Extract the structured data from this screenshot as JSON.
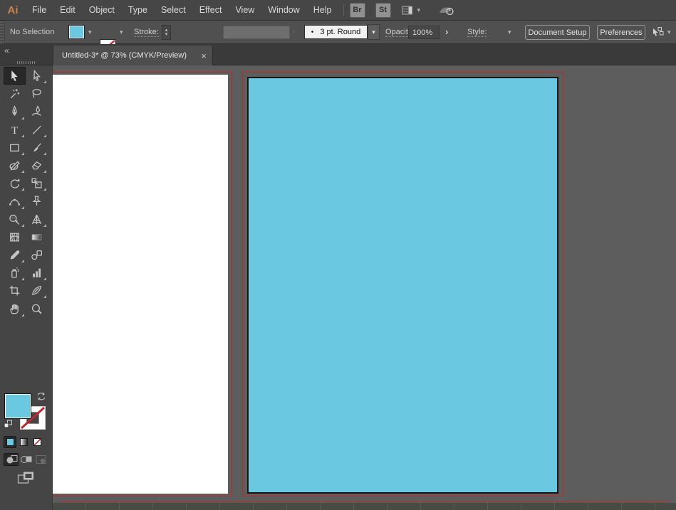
{
  "app": {
    "name": "Adobe Illustrator",
    "logo_text": "Ai",
    "brand_color": "#c8834e"
  },
  "glyphs": {
    "chevron_down": "▾",
    "stepper_up": "▴",
    "stepper_down": "▾",
    "forward": "›",
    "collapse": "«",
    "bullet": "•"
  },
  "menubar": {
    "items": [
      "File",
      "Edit",
      "Object",
      "Type",
      "Select",
      "Effect",
      "View",
      "Window",
      "Help"
    ],
    "app_buttons": [
      "Br",
      "St"
    ]
  },
  "control_bar": {
    "selection_status": "No Selection",
    "fill_color": "#6ac8e0",
    "stroke_swatch": "none",
    "stroke_label": "Stroke:",
    "stroke_width_value": "",
    "brush_definition": "3 pt. Round",
    "opacity_label": "Opacity:",
    "opacity_value": "100%",
    "style_label": "Style:",
    "document_setup_label": "Document Setup",
    "preferences_label": "Preferences"
  },
  "document_tab": {
    "title": "Untitled-3* @ 73% (CMYK/Preview)",
    "close_glyph": "×",
    "zoom_percent": "73%",
    "color_mode": "CMYK/Preview"
  },
  "toolbar": {
    "active_tool": "selection-tool",
    "fill_color": "#6ac8e0",
    "stroke_style": "none",
    "tools": [
      {
        "name": "selection-tool",
        "active": true,
        "flyout": false
      },
      {
        "name": "direct-selection-tool",
        "active": false,
        "flyout": true
      },
      {
        "name": "magic-wand-tool",
        "active": false,
        "flyout": false
      },
      {
        "name": "lasso-tool",
        "active": false,
        "flyout": false
      },
      {
        "name": "pen-tool",
        "active": false,
        "flyout": true
      },
      {
        "name": "curvature-tool",
        "active": false,
        "flyout": false
      },
      {
        "name": "type-tool",
        "active": false,
        "flyout": true
      },
      {
        "name": "line-segment-tool",
        "active": false,
        "flyout": true
      },
      {
        "name": "rectangle-tool",
        "active": false,
        "flyout": true
      },
      {
        "name": "paintbrush-tool",
        "active": false,
        "flyout": true
      },
      {
        "name": "pencil-tool",
        "active": false,
        "flyout": true
      },
      {
        "name": "eraser-tool",
        "active": false,
        "flyout": true
      },
      {
        "name": "rotate-tool",
        "active": false,
        "flyout": true
      },
      {
        "name": "scale-tool",
        "active": false,
        "flyout": true
      },
      {
        "name": "width-tool",
        "active": false,
        "flyout": true
      },
      {
        "name": "puppet-warp-tool",
        "active": false,
        "flyout": false
      },
      {
        "name": "shape-builder-tool",
        "active": false,
        "flyout": true
      },
      {
        "name": "perspective-grid-tool",
        "active": false,
        "flyout": true
      },
      {
        "name": "mesh-tool",
        "active": false,
        "flyout": false
      },
      {
        "name": "gradient-tool",
        "active": false,
        "flyout": false
      },
      {
        "name": "eyedropper-tool",
        "active": false,
        "flyout": true
      },
      {
        "name": "blend-tool",
        "active": false,
        "flyout": false
      },
      {
        "name": "symbol-sprayer-tool",
        "active": false,
        "flyout": true
      },
      {
        "name": "column-graph-tool",
        "active": false,
        "flyout": true
      },
      {
        "name": "artboard-tool",
        "active": false,
        "flyout": false
      },
      {
        "name": "slice-tool",
        "active": false,
        "flyout": true
      },
      {
        "name": "hand-tool",
        "active": false,
        "flyout": true
      },
      {
        "name": "zoom-tool",
        "active": false,
        "flyout": false
      }
    ],
    "drawing_modes": [
      {
        "name": "draw-normal-mode",
        "selected": true,
        "disabled": false
      },
      {
        "name": "draw-behind-mode",
        "selected": false,
        "disabled": false
      },
      {
        "name": "draw-inside-mode",
        "selected": false,
        "disabled": true
      }
    ]
  },
  "canvas": {
    "background_color": "#5d5d5d",
    "bleed_guide_color": "#b92b2b",
    "artboards": [
      {
        "name": "artboard-1",
        "fill_color": "#ffffff"
      },
      {
        "name": "artboard-2",
        "fill_color": "#6ac8e0",
        "stroke_color": "#161616"
      }
    ]
  }
}
